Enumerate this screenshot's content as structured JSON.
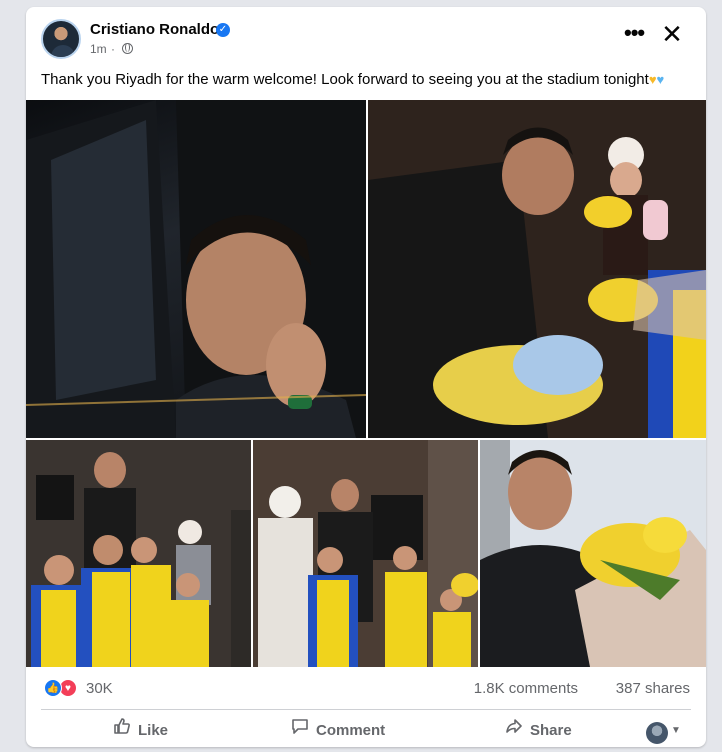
{
  "post": {
    "author": "Cristiano Ronaldo",
    "verified_icon": "verified-badge-icon",
    "time": "1m",
    "audience_icon": "globe-icon",
    "message": "Thank you Riyadh for the warm welcome! Look forward to seeing you at the stadium tonight",
    "emoji": [
      "yellow-heart",
      "blue-heart"
    ]
  },
  "header": {
    "more_icon": "more-options-icon",
    "close_icon": "close-icon"
  },
  "photos": [
    {
      "name": "photo-car-wave"
    },
    {
      "name": "photo-flowers-children"
    },
    {
      "name": "photo-group-children"
    },
    {
      "name": "photo-group-men-children"
    },
    {
      "name": "photo-holding-bouquet"
    }
  ],
  "stats": {
    "reactions": "30K",
    "comments": "1.8K comments",
    "shares": "387 shares"
  },
  "actions": {
    "like": "Like",
    "comment": "Comment",
    "share": "Share"
  },
  "colors": {
    "accent": "#1877f2",
    "love": "#f33e58",
    "secondary_text": "#65676b",
    "yellow_heart": "#f7b928",
    "blue_heart": "#5ab4f0"
  }
}
